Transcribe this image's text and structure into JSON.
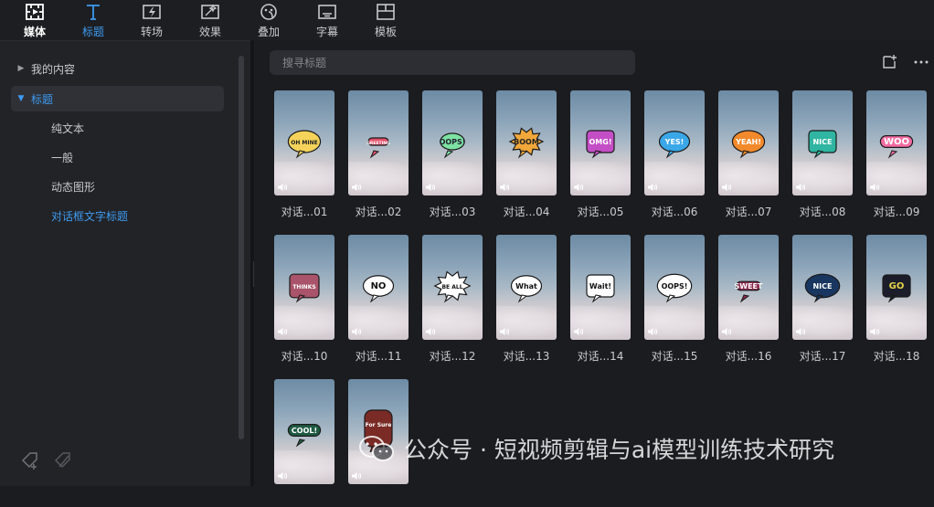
{
  "nav": {
    "tabs": [
      {
        "label": "媒体",
        "icon": "media-icon"
      },
      {
        "label": "标题",
        "icon": "title-icon"
      },
      {
        "label": "转场",
        "icon": "transition-icon"
      },
      {
        "label": "效果",
        "icon": "effects-icon"
      },
      {
        "label": "叠加",
        "icon": "overlay-icon"
      },
      {
        "label": "字幕",
        "icon": "subtitle-icon"
      },
      {
        "label": "模板",
        "icon": "template-icon"
      }
    ],
    "active": "标题"
  },
  "sidebar": {
    "tree": [
      {
        "label": "我的内容",
        "expanded": false
      },
      {
        "label": "标题",
        "expanded": true
      }
    ],
    "subitems": [
      "纯文本",
      "一般",
      "动态图形",
      "对话框文字标题"
    ],
    "active_subitem": "对话框文字标题",
    "footer_icons": [
      "add-tag-icon",
      "remove-tag-icon"
    ]
  },
  "search": {
    "placeholder": "搜寻标题",
    "value": ""
  },
  "toolbar": {
    "icons": [
      "new-item-icon",
      "more-icon"
    ]
  },
  "cards": [
    {
      "label": "对话...01",
      "sticker": "OH MINE"
    },
    {
      "label": "对话...02",
      "sticker": "GREETING"
    },
    {
      "label": "对话...03",
      "sticker": "OOPS!"
    },
    {
      "label": "对话...04",
      "sticker": "BOOM"
    },
    {
      "label": "对话...05",
      "sticker": "OMG!"
    },
    {
      "label": "对话...06",
      "sticker": "YES!"
    },
    {
      "label": "对话...07",
      "sticker": "YEAH!"
    },
    {
      "label": "对话...08",
      "sticker": "NICE"
    },
    {
      "label": "对话...09",
      "sticker": "WOO"
    },
    {
      "label": "对话...10",
      "sticker": "THINKS"
    },
    {
      "label": "对话...11",
      "sticker": "NO"
    },
    {
      "label": "对话...12",
      "sticker": "BE ALL"
    },
    {
      "label": "对话...13",
      "sticker": "What"
    },
    {
      "label": "对话...14",
      "sticker": "Wait!"
    },
    {
      "label": "对话...15",
      "sticker": "OOPS!"
    },
    {
      "label": "对话...16",
      "sticker": "SWEET"
    },
    {
      "label": "对话...17",
      "sticker": "NICE"
    },
    {
      "label": "对话...18",
      "sticker": "GO"
    },
    {
      "label": "",
      "sticker": "COOL!"
    },
    {
      "label": "",
      "sticker": "For Sure"
    }
  ],
  "watermark": {
    "text": "公众号 · 短视频剪辑与ai模型训练技术研究"
  },
  "colors": {
    "accent": "#3e9bf0",
    "background": "#1b1c20",
    "sidebar": "#222327"
  }
}
